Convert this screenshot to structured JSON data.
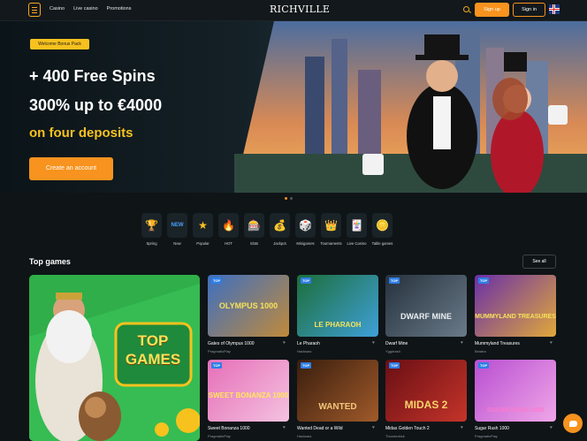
{
  "header": {
    "nav": [
      "Casino",
      "Live casino",
      "Promotions"
    ],
    "logo": "RICHVILLE",
    "signup_label": "Sign up",
    "signin_label": "Sign in"
  },
  "hero": {
    "badge": "Welcome Bonus Pack",
    "line1": "+ 400 Free Spins",
    "line2": "300% up to €4000",
    "line3": "on four deposits",
    "cta": "Create an account"
  },
  "categories": [
    {
      "label": "Spring",
      "icon": "trophy-icon"
    },
    {
      "label": "New",
      "icon": "new-badge-icon"
    },
    {
      "label": "Popular",
      "icon": "star-icon"
    },
    {
      "label": "HOT",
      "icon": "fire-icon"
    },
    {
      "label": "Slots",
      "icon": "slot-machine-icon"
    },
    {
      "label": "Jackpot",
      "icon": "money-bag-icon"
    },
    {
      "label": "Minigames",
      "icon": "dice-icon"
    },
    {
      "label": "Tournaments",
      "icon": "crown-icon"
    },
    {
      "label": "Live Casino",
      "icon": "cards-icon"
    },
    {
      "label": "Table games",
      "icon": "chips-icon"
    }
  ],
  "top_games": {
    "title": "Top games",
    "see_all": "See all",
    "promo_text": "TOP GAMES",
    "games": [
      {
        "name": "Gates of Olympus 1000",
        "provider": "PragmaticPlay",
        "badge": "TOP",
        "thumb_text": "OLYMPUS 1000",
        "color": "#4a6fb5"
      },
      {
        "name": "Le Pharaoh",
        "provider": "Hacksaw",
        "badge": "TOP",
        "thumb_text": "LE PHARAOH",
        "color": "#2b7d4a"
      },
      {
        "name": "Dwarf Mine",
        "provider": "Yggdrasil",
        "badge": "TOP",
        "thumb_text": "DWARF MINE",
        "color": "#3b4a5a"
      },
      {
        "name": "Mummyland Treasures",
        "provider": "Belatra",
        "badge": "TOP",
        "thumb_text": "MUMMYLAND TREASURES",
        "color": "#7b3fb0"
      },
      {
        "name": "Sweet Bonanza 1000",
        "provider": "PragmaticPlay",
        "badge": "TOP",
        "thumb_text": "SWEET BONANZA 1000",
        "color": "#e06ab5"
      },
      {
        "name": "Wanted Dead or a Wild",
        "provider": "Hacksaw",
        "badge": "TOP",
        "thumb_text": "WANTED",
        "color": "#6b3b1e"
      },
      {
        "name": "Midas Golden Touch 2",
        "provider": "Thunderkick",
        "badge": "TOP",
        "thumb_text": "MIDAS 2",
        "color": "#8a1e1e"
      },
      {
        "name": "Sugar Rush 1000",
        "provider": "PragmaticPlay",
        "badge": "TOP",
        "thumb_text": "SUGAR RUSH 1000",
        "color": "#c75fd1"
      }
    ]
  }
}
